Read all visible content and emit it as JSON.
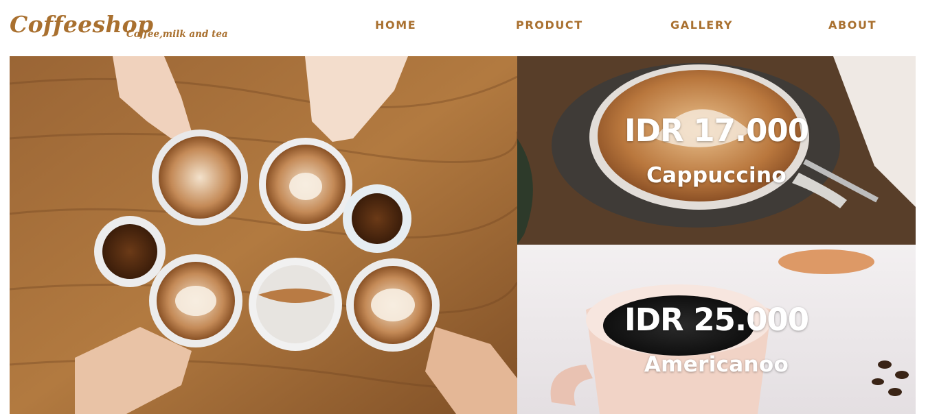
{
  "brand": {
    "logo": "Coffeeshop",
    "tagline": "Coffee,milk and tea"
  },
  "nav": {
    "items": [
      "HOME",
      "PRODUCT",
      "GALLERY",
      "ABOUT"
    ]
  },
  "products": [
    {
      "price": "IDR 17.000",
      "name": "Cappuccino"
    },
    {
      "price": "IDR 25.000",
      "name": "Americanoo"
    }
  ],
  "colors": {
    "accent": "#a9702f",
    "wood": "#8a5a2e",
    "background": "#ffffff"
  }
}
